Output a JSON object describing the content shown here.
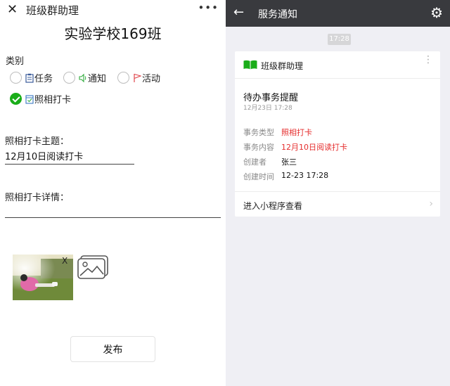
{
  "left": {
    "header": {
      "close_glyph": "✕",
      "app_title": "班级群助理",
      "more_glyph": "•••"
    },
    "page_title": "实验学校169班",
    "category": {
      "label": "类别",
      "options": [
        {
          "label": "任务",
          "icon": "clipboard-icon",
          "checked": false
        },
        {
          "label": "通知",
          "icon": "speaker-icon",
          "checked": false
        },
        {
          "label": "活动",
          "icon": "flag-icon",
          "checked": false
        },
        {
          "label": "照相打卡",
          "icon": "calendar-check-icon",
          "checked": true
        }
      ]
    },
    "topic": {
      "label": "照相打卡主题：",
      "value": "12月10日阅读打卡"
    },
    "details": {
      "label": "照相打卡详情：",
      "value": ""
    },
    "photo": {
      "remove_glyph": "X"
    },
    "publish_label": "发布"
  },
  "right": {
    "nav": {
      "back_glyph": "←",
      "title": "服务通知",
      "gear_glyph": "⚙"
    },
    "time_badge": "17:28",
    "card": {
      "app_name": "班级群助理",
      "menu_glyph": "⋮",
      "notice_title": "待办事务提醒",
      "notice_date": "12月23日  17:28",
      "rows": [
        {
          "key": "事务类型",
          "value": "照相打卡",
          "highlight": true
        },
        {
          "key": "事务内容",
          "value": "12月10日阅读打卡",
          "highlight": true
        },
        {
          "key": "创建者",
          "value": "张三",
          "highlight": false
        },
        {
          "key": "创建时间",
          "value": "12-23 17:28",
          "highlight": false
        }
      ],
      "footer_label": "进入小程序查看",
      "chevron_glyph": "›"
    }
  },
  "colors": {
    "accent_green": "#1aad19",
    "highlight_red": "#e52d2d",
    "nav_dark": "#393a3e"
  }
}
